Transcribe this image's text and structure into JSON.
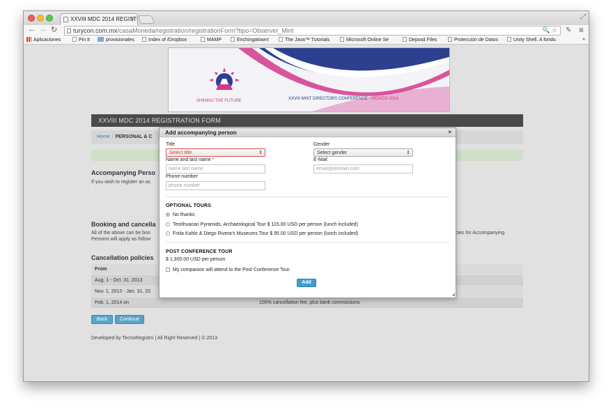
{
  "browser": {
    "tab_title": "XXVIII MDC 2014 REGISTR...",
    "url_host": "turycon.com.mx",
    "url_path": "/casaMoneda/registration/registrationForm?tipo=Observer_Mint",
    "bookmarks": [
      "Aplicaciones",
      "Pin It",
      "provisionales",
      "Index of /Dropbox",
      "MAMP",
      "Enchingatown!",
      "The Java™ Tutorials",
      "Microsoft Online Se",
      "Deposit Files",
      "Protección de Datos",
      "Unity Shell. A fondo."
    ]
  },
  "banner": {
    "shining": "SHINING THE FUTURE",
    "conference": "XXVIII MINT DIRECTORS CONFERENCE - ",
    "location": "MEXICO 2014"
  },
  "page": {
    "form_title": "XXVIII MDC 2014 REGISTRATION FORM",
    "breadcrumb_home": "Home",
    "breadcrumb_current": "PERSONAL & C",
    "accompanying_heading": "Accompanying Perso",
    "accompanying_text": "If you wish to register an ac",
    "booking_heading": "Booking and cancella",
    "booking_text_1": "All of the above can be boo",
    "booking_text_2": "Persons will apply as follow",
    "booking_text_right": "licies for Accompanying",
    "cancel_heading": "Cancellation policies",
    "table_header": "From",
    "rows": [
      {
        "from": "Aug. 1 - Oct. 31, 2013",
        "policy": ""
      },
      {
        "from": "Nov. 1, 2013 - Jan. 31, 20",
        "policy": ""
      },
      {
        "from": "Feb. 1, 2014 on",
        "policy": "100% cancellation fee, plus bank commissions"
      }
    ],
    "back_label": "Back",
    "continue_label": "Continue",
    "footer": "Developed by TecnoRegistro | All Right Reserved | © 2013"
  },
  "modal": {
    "title": "Add accompanying person",
    "close": "×",
    "title_label": "Title",
    "title_value": "Select title",
    "gender_label": "Gender",
    "gender_value": "Select gender",
    "name_label": "Name and last name",
    "required_mark": "*",
    "name_placeholder": "name last name",
    "email_label": "E-Mail",
    "email_placeholder": "email@domain.com",
    "phone_label": "Phone number",
    "phone_placeholder": "phone number",
    "optional_tours_heading": "OPTIONAL TOURS",
    "tours": [
      {
        "label": "No thanks",
        "checked": true
      },
      {
        "label": "Teotihuacan Pyramids, Archaeological Tour $ 115.00 USD per person (lunch included)",
        "checked": false
      },
      {
        "label": "Frida Kahlo & Diego Rivera's Museums Tour $ 95.00 USD per person (lunch included)",
        "checked": false
      }
    ],
    "post_tour_heading": "POST CONFERENCE TOUR",
    "post_tour_price": "$ 1,300.00 USD per person",
    "post_tour_checkbox": "My companion will attend to the Post Conference Tour.",
    "add_label": "Add"
  }
}
